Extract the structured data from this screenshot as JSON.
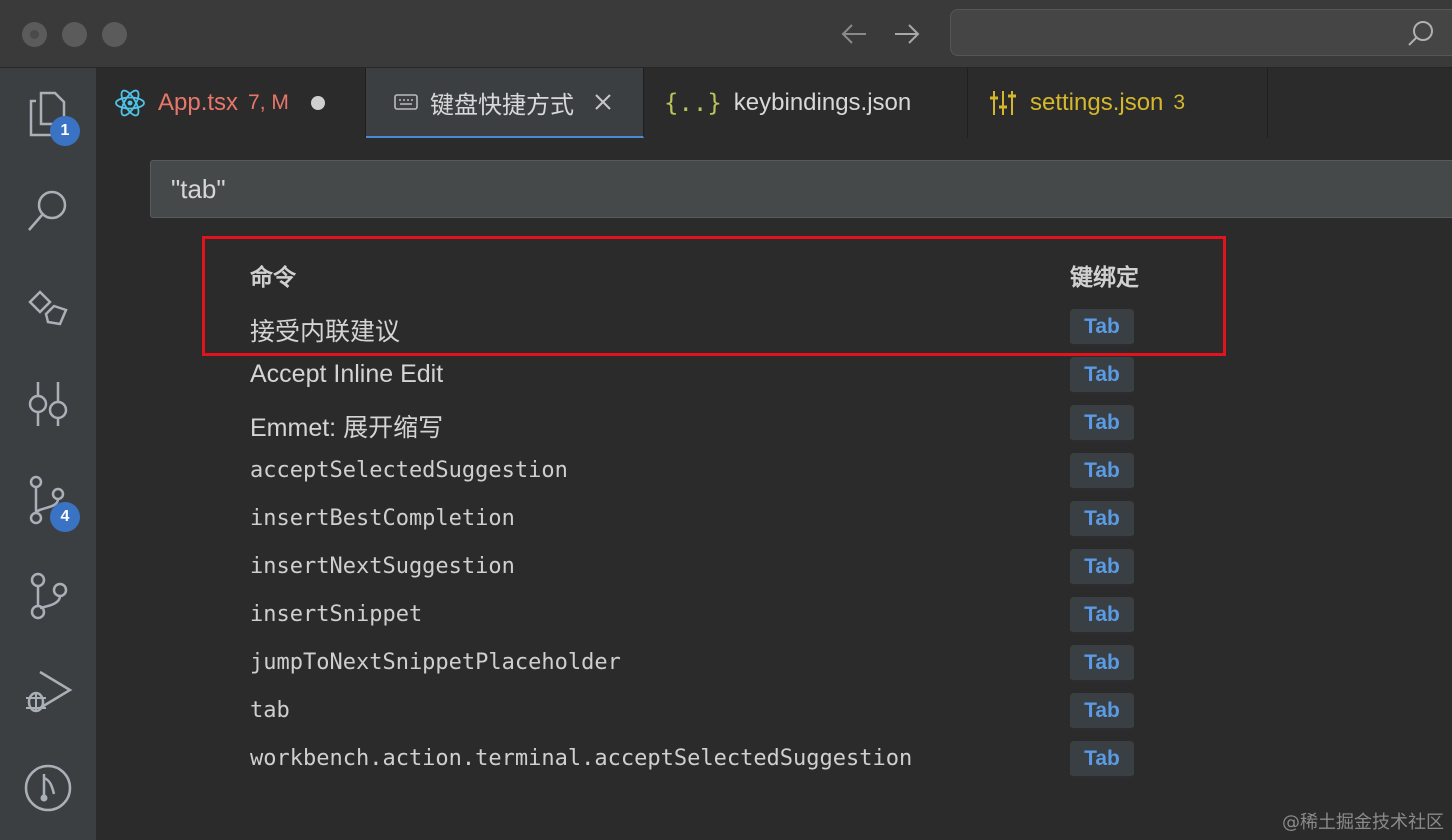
{
  "titlebar": {
    "back_icon": "arrow-left-icon",
    "forward_icon": "arrow-right-icon",
    "search_icon": "search-icon"
  },
  "activity_bar": {
    "items": [
      {
        "icon": "explorer-files-icon",
        "badge": "1"
      },
      {
        "icon": "search-icon",
        "badge": null
      },
      {
        "icon": "extensions-icon",
        "badge": null
      },
      {
        "icon": "source-control-graph-icon",
        "badge": null
      },
      {
        "icon": "git-branch-icon",
        "badge": "4"
      },
      {
        "icon": "git-merge-icon",
        "badge": null
      },
      {
        "icon": "run-debug-icon",
        "badge": null
      },
      {
        "icon": "git-compare-icon",
        "badge": null
      }
    ]
  },
  "tabs": [
    {
      "label": "App.tsx",
      "extra": "7, M",
      "icon": "react-icon",
      "color": "#e8776b",
      "dirty": true
    },
    {
      "label": "键盘快捷方式",
      "icon": "keyboard-icon",
      "color": "#cccccc",
      "active": true
    },
    {
      "label": "keybindings.json",
      "icon": "json-braces-icon",
      "color": "#d8d8d8"
    },
    {
      "label": "settings.json",
      "extra": "3",
      "icon": "settings-sliders-icon",
      "color": "#d4b72a"
    }
  ],
  "search": {
    "value": "\"tab\""
  },
  "table": {
    "headers": {
      "command": "命令",
      "keybinding": "键绑定"
    },
    "rows": [
      {
        "command": "接受内联建议",
        "key": "Tab",
        "mono": false
      },
      {
        "command": "Accept Inline Edit",
        "key": "Tab",
        "mono": false
      },
      {
        "command": "Emmet: 展开缩写",
        "key": "Tab",
        "mono": false
      },
      {
        "command": "acceptSelectedSuggestion",
        "key": "Tab",
        "mono": true
      },
      {
        "command": "insertBestCompletion",
        "key": "Tab",
        "mono": true
      },
      {
        "command": "insertNextSuggestion",
        "key": "Tab",
        "mono": true
      },
      {
        "command": "insertSnippet",
        "key": "Tab",
        "mono": true
      },
      {
        "command": "jumpToNextSnippetPlaceholder",
        "key": "Tab",
        "mono": true
      },
      {
        "command": "tab",
        "key": "Tab",
        "mono": true
      },
      {
        "command": "workbench.action.terminal.acceptSelectedSuggestion",
        "key": "Tab",
        "mono": true
      }
    ]
  },
  "colors": {
    "accent_blue": "#3b73c4",
    "key_blue": "#5a9be6",
    "highlight_red": "#e1141e",
    "settings_yellow": "#d4b72a",
    "app_red": "#e8776b"
  },
  "watermark": "@稀土掘金技术社区"
}
